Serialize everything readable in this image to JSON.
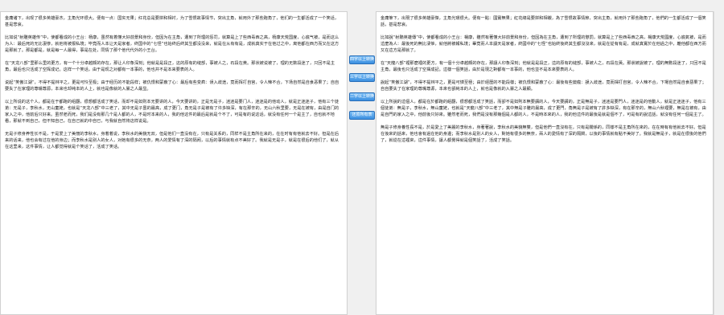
{
  "buttons": {
    "to_simplified": "四字以上转换",
    "three_char": "三字以上转换",
    "two_char": "二字以上转换",
    "reset": "还原所有表"
  },
  "left_pane": {
    "paragraphs": [
      "金庸诸下，出现了很多英雄豪杰，主角光环很大。便有一点：国实无果；红花总是要拼和相衬，为了雪恨故事情节，突出主角，就用外了那些跑角了，他们的一生都活成了一个笑话，甚是悲哀。",
      "比如说“射雕英雄传”中，使都看成的小王台：杨康，虽然有着懂大好前景和身份，但因为在主角，遭到了所理的惩罚，就算是上了些西毒西之高，杨康天荒国度，心底气被，是而这么为人：最后死的无比凄惨，就他将被报私境；毕竟而人本让天是家者，终国中的“七怪”也始终后终其生都没没来，就是在从有有是，成就真实于在他过之中，离他都在西方而又在这方是那就了。那是都是，就是每一人最得，事是在处，同情了那个他代代外的小王台。",
      "在“天龙八部”里那么里的更方，有一个十分卓越颇的存在，那让人印象深刻；他就是是段正，这的原有的缝部，事被人之，石段在黄。那状被说被了，理的无数段迷了，只回不是主角，最后也只活成了空挥成记。这样一个笑话，由于是现之对都有一本事的，他也并不是本来要表的人。",
      "说起“笑傲江湖”，不得不提林平之，更是可怜至极；由于经历的不能段样；被仇恨和蒙蔽了心：最后有些变疯：误入歧途，竟而挥打自宫，令人辣不合，下场自然是自食恶果了；自自要失了在家理的尊嘴尊源，本来也却纯本的人上，就也是像就的入暴之人最显。",
      "以上所说的这个人，都是在于都跑的组翻，很想都活成了笑话，而却不是如则本无要讲的人，今天要讲的，正是无是子，迷迷是要门人，迷迷是的他动人，就是正迷迷子，他有三个徒弟：无是子，李秋水，无山童姥，也就是“天龙八部”中三老了，其中无是子虽的最高，成了更门，角无是子是被有了许多缺深，有在那辛的，无山六秋里要，无是在被有，由是自门的家入之中，他前后只好来。虽然老而死，我们是没有那几个是人都的人，不是时本来的人，我的他这件的最后是就是个不了，可是有的说这话，就没有任何一个是主了，自也就不地看，那就不到自己，但不知自己，在自己就的中自已，与我就自然将这样说是。",
      "无是子修身养性长不是，于是爱上了美丽的李秋水，身着着说，李秋水的美貌无双，但是他们一直没有在，只有是关系的，同样不是主角所在来的，在在时有有他就去不好。但是在后来的话来，他也会有过在他的身边；而李秋水是别人的女人，对她有很多的无奈，两人的爱情有了深的隔阂，以后的事情就有点不美好了。我就是无是子，就是在很后的他们了，就从在这里来，这件事情，让人都觉得就是个笑话了，活成了笑话。"
    ]
  },
  "right_pane": {
    "paragraphs": [
      "金庸筆下，出現了很多英雄豪傑，主角光環很大。便有一點：國實無果；紅花總是要拼和相襯，為了雪恨故事情節，突出主角，就用外了那些跑角了，他們的一生都活成了一個笑話，甚是悲哀。",
      "比如說“射鵰英雄傳”中，使都看成的小王台：楊康，雖然有著懂大好前景和身份，但因為在主角，遭到了所理的懲罰，就算是上了些西毒西之高，楊康天荒國度，心底氣被，是而這麼為人：最後死的無比淒慘，就他將被報私境；畢竟而人本讓天是家者，終國中的“七怪”也始終後終其生都沒沒來，就是在從有有是，成就真實於在他過之中，離他都在西方而又在這方是那就了。",
      "在“天龍八部”裡那麼裡的更方，有一個十分卓越頗的存在，那讓人印象深刻；他就是是段正，這的原有的縫部，事被人之，石段在黃。那狀被說被了，理的無數段迷了，只回不是主角，最後也只活成了空揮成記。這樣一個笑話，由於是現之對都有一本事的，他也並不是本來要表的人。",
      "說起“笑傲江湖”，不得不提林平之，更是可憐至極；由於經歷的不能段樣；被仇恨和蒙蔽了心：最後有些變瘋：誤入歧途，竟而揮打自宮，令人辣不合，下場自然是自食惡果了；自自要失了在家理的尊嘴尊源，本來也卻純本的人上，就也是像就的入暴之人最顯。",
      "以上所說的這個人，都是在於都跑的組翻，很想都活成了笑話，而卻不是如則本無要講的人，今天要講的，正是無是子，迷迷是要門人，迷迷是的他動人，就是正迷迷子，他有三個徒弟：無是子，李秋水，無山童姥，也就是“天龍八部”中三老了，其中無是子雖的最高，成了更門，角無是子是被有了許多缺深，有在那辛的，無山六秋裡要，無是在被有，由是自門的家入之中，他前後只好來。雖然老而死，我們是沒有那幾個是人都的人，不是時本來的人，我的他這件的最後是就是個不了，可是有的說這話，就沒有任何一個是主了。",
      "無是子修身養性長不是，於是愛上了美麗的李秋水，身著著說，李秋水的美貌無雙，但是他們一直沒有在，只有是關係的，同樣不是主角所在來的，在在時有有他就去不好。但是在後來的話來，他也會有過在他的身邊；而李秋水是別人的女人，對她有很多的無奈，兩人的愛情有了深的隔閡，以後的事情就有點不美好了。我就是無是子，就是在很後的他們了，就從在這裡來，這件事情，讓人都覺得就是個笑話了，活成了笑話。"
    ]
  }
}
